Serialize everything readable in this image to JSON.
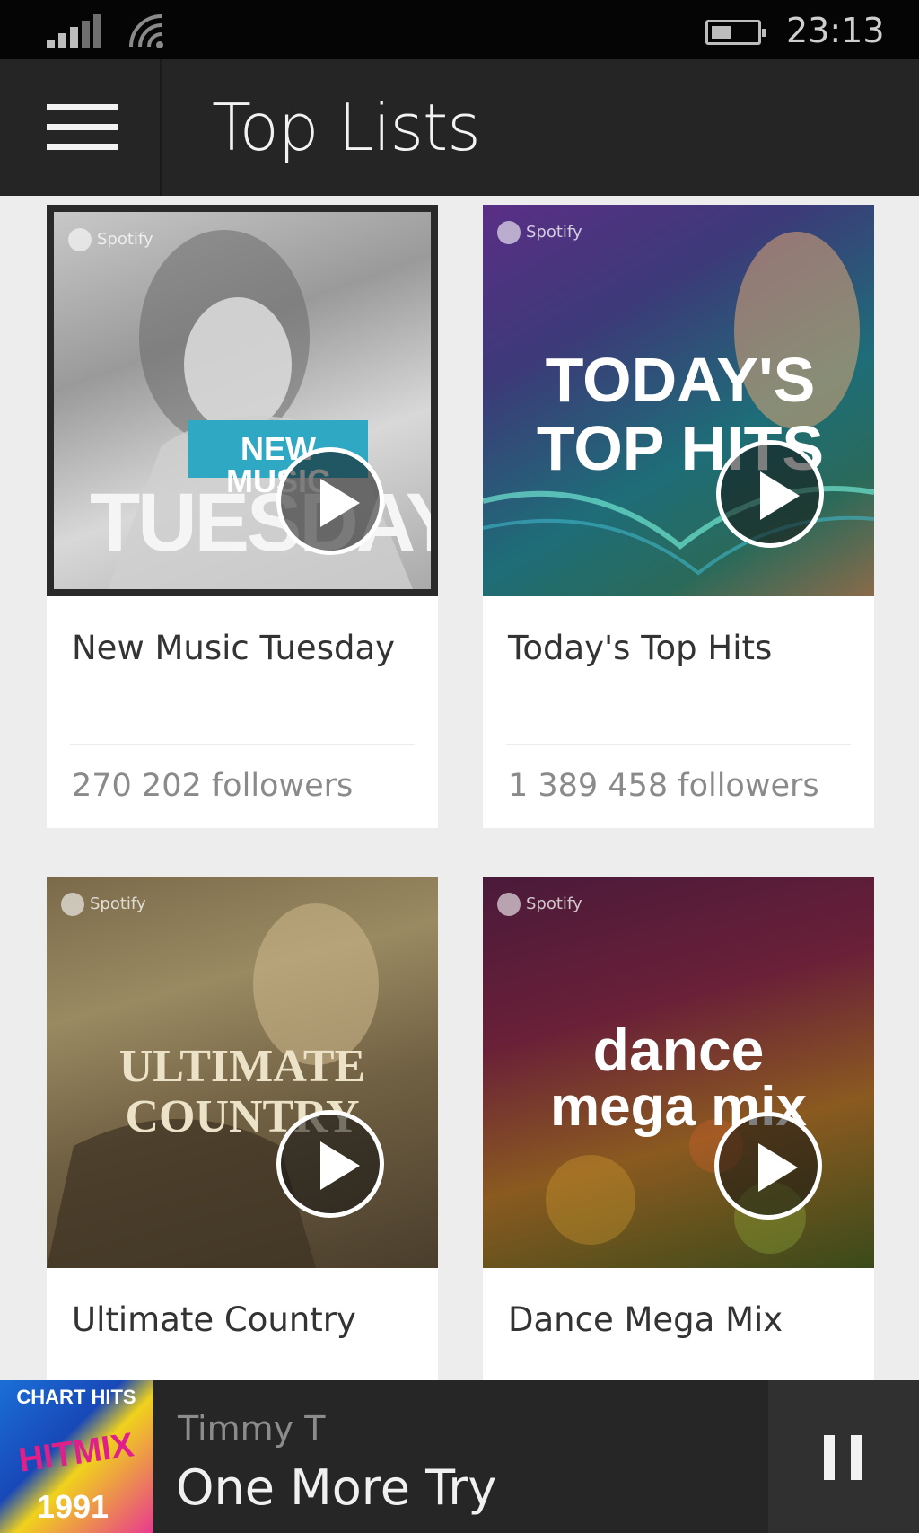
{
  "status_bar": {
    "time": "23:13",
    "icons": [
      "signal-icon",
      "wifi-icon",
      "battery-icon"
    ]
  },
  "header": {
    "title": "Top Lists",
    "menu_icon": "hamburger-menu-icon"
  },
  "playlists": [
    {
      "title": "New Music Tuesday",
      "followers": "270 202 followers",
      "cover": {
        "brand": "Spotify",
        "badge": "NEW MUSIC",
        "headline": "TUESDAY"
      }
    },
    {
      "title": "Today's Top Hits",
      "followers": "1 389 458 followers",
      "cover": {
        "brand": "Spotify",
        "line1": "TODAY'S",
        "line2": "TOP HITS"
      }
    },
    {
      "title": "Ultimate Country",
      "cover": {
        "brand": "Spotify",
        "line1": "ULTIMATE",
        "line2": "COUNTRY"
      }
    },
    {
      "title": "Dance Mega Mix",
      "cover": {
        "brand": "Spotify",
        "line1": "dance",
        "line2": "mega mix"
      }
    }
  ],
  "now_playing": {
    "artist": "Timmy T",
    "title": "One More Try",
    "art": {
      "top": "CHART HITS",
      "middle": "HITMIX",
      "bottom": "1991"
    },
    "control_icon": "pause-icon"
  },
  "colors": {
    "background": "#ededed",
    "header": "#252525",
    "status_bar": "#050505",
    "card": "#ffffff",
    "now_playing": "#262626"
  }
}
